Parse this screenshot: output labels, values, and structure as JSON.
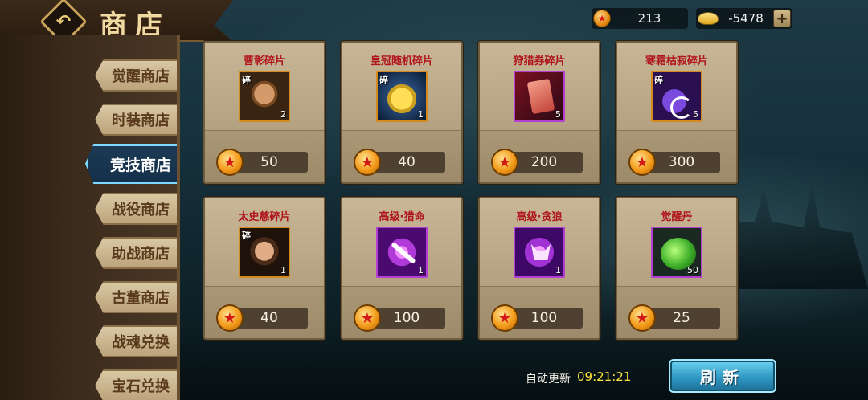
{
  "header": {
    "title": "商店",
    "back_icon": "back-arrow-icon"
  },
  "currency": {
    "coins": "213",
    "gold": "-5478",
    "plus": "+"
  },
  "sidebar": {
    "items": [
      {
        "label": "觉醒商店",
        "active": false
      },
      {
        "label": "时装商店",
        "active": false
      },
      {
        "label": "竞技商店",
        "active": true
      },
      {
        "label": "战役商店",
        "active": false
      },
      {
        "label": "助战商店",
        "active": false
      },
      {
        "label": "古董商店",
        "active": false
      },
      {
        "label": "战魂兑换",
        "active": false
      },
      {
        "label": "宝石兑换",
        "active": false
      }
    ]
  },
  "items": [
    {
      "name": "曹彰碎片",
      "qty": "2",
      "price": "50",
      "fragment": "碎",
      "icon": "caozhang-portrait-icon",
      "rarity_color": "#d48a1c"
    },
    {
      "name": "皇冠随机碎片",
      "qty": "1",
      "price": "40",
      "fragment": "碎",
      "icon": "golden-crown-icon",
      "rarity_color": "#d48a1c"
    },
    {
      "name": "狩猎券碎片",
      "qty": "5",
      "price": "200",
      "fragment": "",
      "icon": "hunting-ticket-icon",
      "rarity_color": "#b23fd1"
    },
    {
      "name": "寒霜枯寂碎片",
      "qty": "5",
      "price": "300",
      "fragment": "碎",
      "icon": "frost-emblem-icon",
      "rarity_color": "#d48a1c"
    },
    {
      "name": "太史慈碎片",
      "qty": "1",
      "price": "40",
      "fragment": "碎",
      "icon": "taishici-portrait-icon",
      "rarity_color": "#d48a1c"
    },
    {
      "name": "高级·猎命",
      "qty": "1",
      "price": "100",
      "fragment": "",
      "icon": "purple-hunt-skill-icon",
      "rarity_color": "#b23fd1"
    },
    {
      "name": "高级·贪狼",
      "qty": "1",
      "price": "100",
      "fragment": "",
      "icon": "purple-wolf-skill-icon",
      "rarity_color": "#b23fd1"
    },
    {
      "name": "觉醒丹",
      "qty": "50",
      "price": "25",
      "fragment": "",
      "icon": "green-pill-icon",
      "rarity_color": "#b23fd1"
    }
  ],
  "footer": {
    "auto_refresh_label": "自动更新",
    "auto_refresh_time": "09:21:21",
    "refresh_button": "刷新"
  }
}
